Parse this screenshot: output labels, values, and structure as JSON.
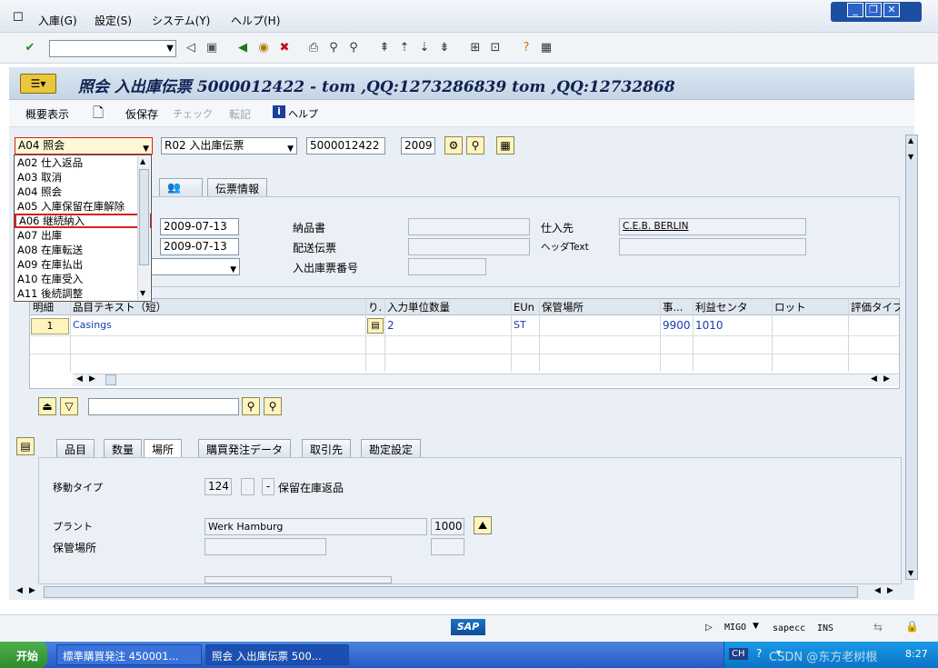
{
  "menu": {
    "items": [
      "入庫(G)",
      "設定(S)",
      "システム(Y)",
      "ヘルプ(H)"
    ]
  },
  "title": {
    "text": "照会 入出庫伝票 5000012422 - tom ,QQ:1273286839 tom ,QQ:12732868"
  },
  "app_toolbar": {
    "overview": "概要表示",
    "hold": "仮保存",
    "check": "チェック",
    "post": "転記",
    "help": "ヘルプ"
  },
  "header_fields": {
    "action": "A04 照会",
    "reference": "R02 入出庫伝票",
    "doc_number": "5000012422",
    "year": "2009"
  },
  "action_dropdown": {
    "items": [
      "A02 仕入返品",
      "A03 取消",
      "A04 照会",
      "A05 入庫保留在庫解除",
      "A06 継続納入",
      "A07 出庫",
      "A08 在庫転送",
      "A09 在庫払出",
      "A10 在庫受入",
      "A11 後続調整"
    ],
    "highlighted": "A06 継続納入"
  },
  "header_tabs": [
    "伝票情報"
  ],
  "header_detail": {
    "doc_date": "2009-07-13",
    "post_date": "2009-07-13",
    "delivery_note_label": "納品書",
    "delivery_note": "",
    "bill_of_lading_label": "配送伝票",
    "bill_of_lading": "",
    "slip_number_label": "入出庫票番号",
    "slip_number": "",
    "vendor_label": "仕入先",
    "vendor": "C.E.B. BERLIN",
    "header_text_label": "ヘッダText",
    "header_text": ""
  },
  "item_table": {
    "columns": [
      "明細",
      "品目テキスト（短）",
      "り.",
      "入力単位数量",
      "EUn",
      "保管場所",
      "事...",
      "利益センタ",
      "ロット",
      "評価タイプ"
    ],
    "rows": [
      {
        "line": "1",
        "material_text": "Casings",
        "qty": "2",
        "unit": "ST",
        "storage": "",
        "bus_area": "9900",
        "profit_center": "1010",
        "batch": "",
        "valuation": ""
      }
    ]
  },
  "detail_tabs": [
    "品目",
    "数量",
    "場所",
    "購買発注データ",
    "取引先",
    "勘定設定"
  ],
  "detail_tab_active": "場所",
  "detail": {
    "movement_type_label": "移動タイプ",
    "movement_type": "124",
    "movement_text": "保留在庫返品",
    "plant_label": "プラント",
    "plant_name": "Werk Hamburg",
    "plant_code": "1000",
    "storage_label": "保管場所"
  },
  "status_bar": {
    "tcode": "MIGO",
    "server": "sapecc",
    "mode": "INS"
  },
  "taskbar": {
    "start": "开始",
    "tasks": [
      "標準購買発注 450001...",
      "照会 入出庫伝票 500..."
    ],
    "lang": "CH",
    "clock": "8:27",
    "watermark": "CSDN @东方老树根"
  },
  "brand": {
    "sap_logo": "SAP"
  }
}
